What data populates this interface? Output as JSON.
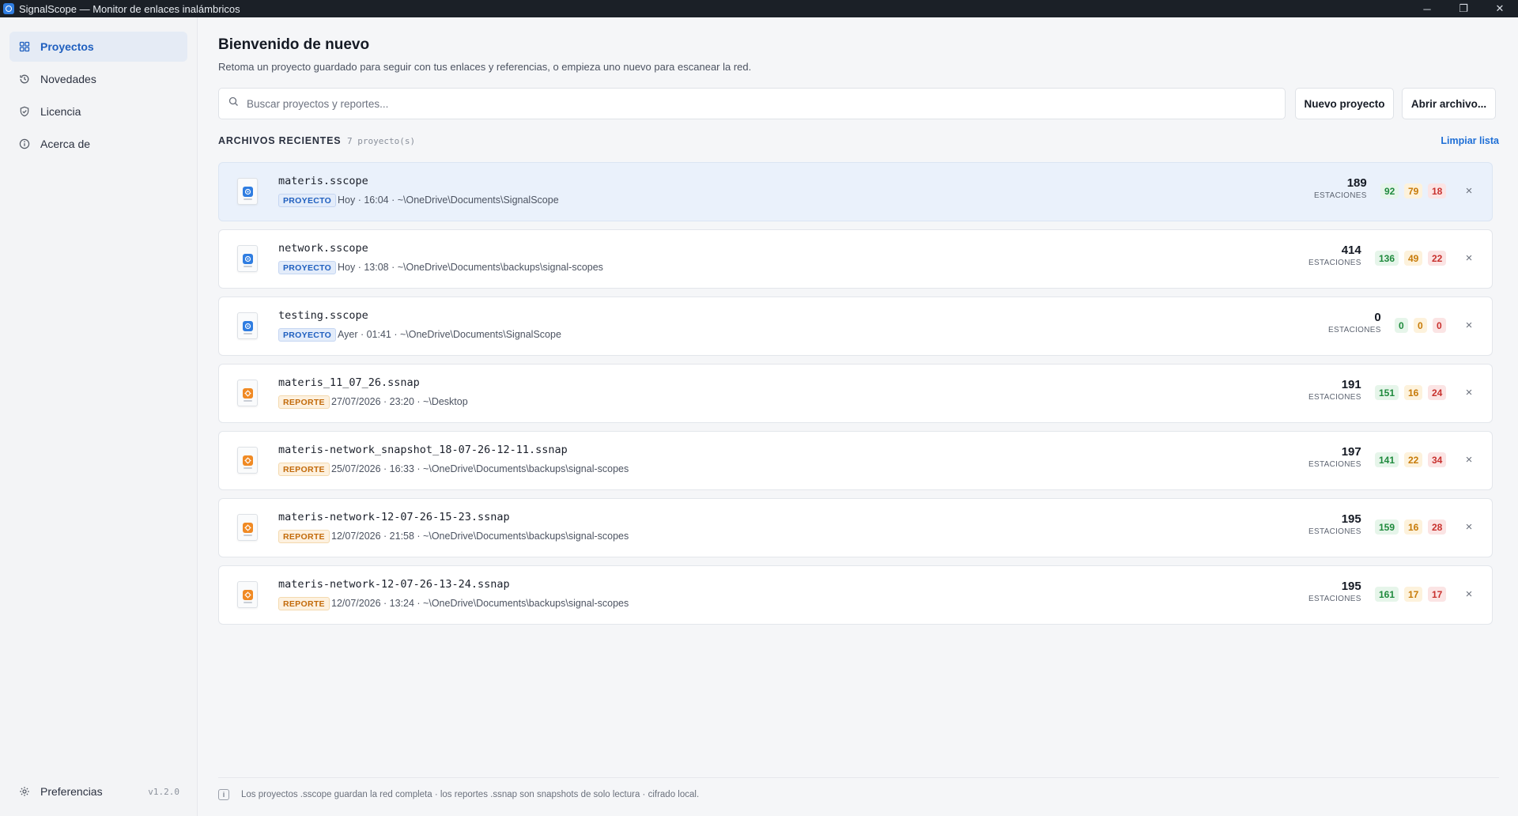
{
  "window": {
    "title": "SignalScope — Monitor de enlaces inalámbricos",
    "minimize": "─",
    "maximize": "❐",
    "close": "✕"
  },
  "sidebar": {
    "items": [
      {
        "label": "Proyectos",
        "icon": "grid-icon",
        "active": true
      },
      {
        "label": "Novedades",
        "icon": "history-icon",
        "active": false
      },
      {
        "label": "Licencia",
        "icon": "shield-check-icon",
        "active": false
      },
      {
        "label": "Acerca de",
        "icon": "info-circle-icon",
        "active": false
      }
    ],
    "preferences": "Preferencias",
    "version": "v1.2.0"
  },
  "main": {
    "title": "Bienvenido de nuevo",
    "subtitle": "Retoma un proyecto guardado para seguir con tus enlaces y referencias, o empieza uno nuevo para escanear la red.",
    "search_placeholder": "Buscar proyectos y reportes...",
    "new_project": "Nuevo proyecto",
    "open_file": "Abrir archivo...",
    "recent_label": "ARCHIVOS RECIENTES",
    "recent_count": "7 proyecto(s)",
    "clear_list": "Limpiar lista",
    "stations_label": "ESTACIONES"
  },
  "recent_files": [
    {
      "name": "materis.sscope",
      "kind": "proyecto",
      "badge": "PROYECTO",
      "meta": "Hoy · 16:04 · ~\\OneDrive\\Documents\\SignalScope",
      "stations": "189",
      "good": "92",
      "warn": "79",
      "bad": "18",
      "selected": true
    },
    {
      "name": "network.sscope",
      "kind": "proyecto",
      "badge": "PROYECTO",
      "meta": "Hoy · 13:08 · ~\\OneDrive\\Documents\\backups\\signal-scopes",
      "stations": "414",
      "good": "136",
      "warn": "49",
      "bad": "22",
      "selected": false
    },
    {
      "name": "testing.sscope",
      "kind": "proyecto",
      "badge": "PROYECTO",
      "meta": "Ayer · 01:41 · ~\\OneDrive\\Documents\\SignalScope",
      "stations": "0",
      "good": "0",
      "warn": "0",
      "bad": "0",
      "selected": false
    },
    {
      "name": "materis_11_07_26.ssnap",
      "kind": "reporte",
      "badge": "REPORTE",
      "meta": "27/07/2026 · 23:20 · ~\\Desktop",
      "stations": "191",
      "good": "151",
      "warn": "16",
      "bad": "24",
      "selected": false
    },
    {
      "name": "materis-network_snapshot_18-07-26-12-11.ssnap",
      "kind": "reporte",
      "badge": "REPORTE",
      "meta": "25/07/2026 · 16:33 · ~\\OneDrive\\Documents\\backups\\signal-scopes",
      "stations": "197",
      "good": "141",
      "warn": "22",
      "bad": "34",
      "selected": false
    },
    {
      "name": "materis-network-12-07-26-15-23.ssnap",
      "kind": "reporte",
      "badge": "REPORTE",
      "meta": "12/07/2026 · 21:58 · ~\\OneDrive\\Documents\\backups\\signal-scopes",
      "stations": "195",
      "good": "159",
      "warn": "16",
      "bad": "28",
      "selected": false
    },
    {
      "name": "materis-network-12-07-26-13-24.ssnap",
      "kind": "reporte",
      "badge": "REPORTE",
      "meta": "12/07/2026 · 13:24 · ~\\OneDrive\\Documents\\backups\\signal-scopes",
      "stations": "195",
      "good": "161",
      "warn": "17",
      "bad": "17",
      "selected": false
    }
  ],
  "footer": {
    "note": "Los proyectos .sscope guardan la red completa · los reportes .ssnap son snapshots de solo lectura · cifrado local.",
    "icon": "info-icon"
  },
  "colors": {
    "accent": "#1f6fd6",
    "good": "#1f8a3d",
    "warn": "#c77a07",
    "bad": "#c8312e"
  }
}
